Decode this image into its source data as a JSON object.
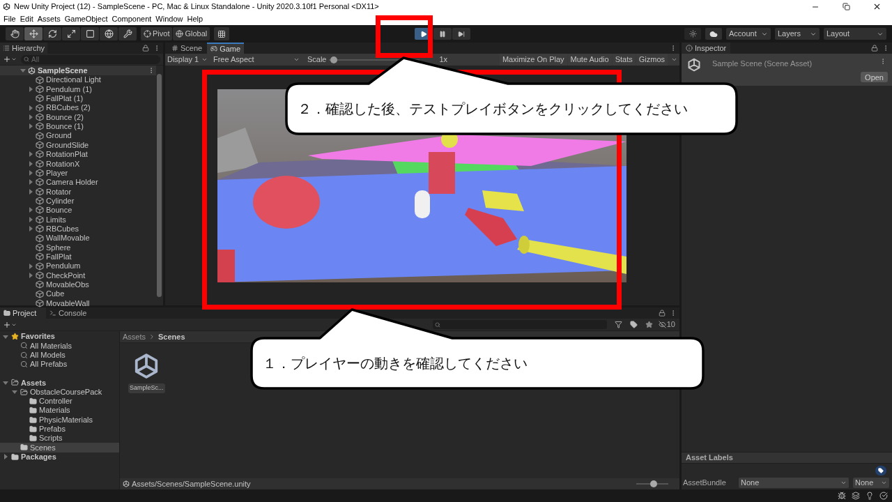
{
  "window": {
    "title": "New Unity Project (12) - SampleScene - PC, Mac & Linux Standalone - Unity 2020.3.10f1 Personal <DX11>"
  },
  "menu": [
    "File",
    "Edit",
    "Assets",
    "GameObject",
    "Component",
    "Window",
    "Help"
  ],
  "toolbar": {
    "tools": [
      {
        "kind": "hand",
        "selected": false
      },
      {
        "kind": "move",
        "selected": true
      },
      {
        "kind": "rotate",
        "selected": false
      },
      {
        "kind": "scale",
        "selected": false
      },
      {
        "kind": "rect",
        "selected": false
      },
      {
        "kind": "transform",
        "selected": false
      },
      {
        "kind": "custom",
        "selected": false
      }
    ],
    "pivot": "Pivot",
    "global": "Global",
    "play_active": true,
    "account": "Account",
    "layers": "Layers",
    "layout": "Layout"
  },
  "hierarchy": {
    "title": "Hierarchy",
    "search_placeholder": "All",
    "scene": {
      "name": "SampleScene",
      "expanded": true
    },
    "items": [
      {
        "name": "Directional Light",
        "expandable": false
      },
      {
        "name": "Pendulum (1)",
        "expandable": true
      },
      {
        "name": "FallPlat (1)",
        "expandable": false
      },
      {
        "name": "RBCubes (2)",
        "expandable": true
      },
      {
        "name": "Bounce (2)",
        "expandable": true
      },
      {
        "name": "Bounce (1)",
        "expandable": true
      },
      {
        "name": "Ground",
        "expandable": false
      },
      {
        "name": "GroundSlide",
        "expandable": false
      },
      {
        "name": "RotationPlat",
        "expandable": true
      },
      {
        "name": "RotationX",
        "expandable": true
      },
      {
        "name": "Player",
        "expandable": true
      },
      {
        "name": "Camera Holder",
        "expandable": true
      },
      {
        "name": "Rotator",
        "expandable": true
      },
      {
        "name": "Cylinder",
        "expandable": false
      },
      {
        "name": "Bounce",
        "expandable": true
      },
      {
        "name": "Limits",
        "expandable": true
      },
      {
        "name": "RBCubes",
        "expandable": true
      },
      {
        "name": "WallMovable",
        "expandable": false
      },
      {
        "name": "Sphere",
        "expandable": false
      },
      {
        "name": "FallPlat",
        "expandable": false
      },
      {
        "name": "Pendulum",
        "expandable": true
      },
      {
        "name": "CheckPoint",
        "expandable": true
      },
      {
        "name": "MovableObs",
        "expandable": false
      },
      {
        "name": "Cube",
        "expandable": false
      },
      {
        "name": "MovableWall",
        "expandable": false
      }
    ]
  },
  "game_panel": {
    "tabs": [
      {
        "label": "Scene",
        "kind": "scene",
        "selected": false
      },
      {
        "label": "Game",
        "kind": "game",
        "selected": true
      }
    ],
    "display": "Display 1",
    "aspect": "Free Aspect",
    "scale_label": "Scale",
    "scale": {
      "level": 0.05
    },
    "scale_value": "1x",
    "buttons": [
      "Maximize On Play",
      "Mute Audio",
      "Stats",
      "Gizmos"
    ]
  },
  "inspector": {
    "title": "Inspector",
    "asset": "Sample Scene (Scene Asset)",
    "open": "Open",
    "asset_labels": "Asset Labels",
    "bundle_label": "AssetBundle",
    "bundle": "None",
    "variant": "None"
  },
  "project": {
    "tabs": [
      {
        "label": "Project",
        "kind": "project",
        "selected": true
      },
      {
        "label": "Console",
        "kind": "console",
        "selected": false
      }
    ],
    "tree": [
      {
        "name": "Favorites",
        "kind": "star",
        "expanded": true,
        "selected": false,
        "children": [
          {
            "name": "All Materials",
            "kind": "search",
            "selected": false
          },
          {
            "name": "All Models",
            "kind": "search",
            "selected": false
          },
          {
            "name": "All Prefabs",
            "kind": "search",
            "selected": false
          }
        ]
      },
      {
        "name": "Assets",
        "kind": "folder",
        "expanded": true,
        "selected": false,
        "children": [
          {
            "name": "ObstacleCoursePack",
            "kind": "folder",
            "expanded": true,
            "selected": false,
            "children": [
              {
                "name": "Controller",
                "kind": "folder",
                "selected": false
              },
              {
                "name": "Materials",
                "kind": "folder",
                "selected": false
              },
              {
                "name": "PhysicMaterials",
                "kind": "folder",
                "selected": false
              },
              {
                "name": "Prefabs",
                "kind": "folder",
                "selected": false
              },
              {
                "name": "Scripts",
                "kind": "folder",
                "selected": false
              }
            ]
          },
          {
            "name": "Scenes",
            "kind": "folder",
            "selected": true
          }
        ]
      },
      {
        "name": "Packages",
        "kind": "folder",
        "expanded": false,
        "selected": false
      }
    ],
    "breadcrumb": [
      "Assets",
      "Scenes"
    ],
    "hidden_count": "10",
    "files": [
      "SampleSc..."
    ],
    "path": "Assets/Scenes/SampleScene.unity",
    "zoom": {
      "level": 0.55
    }
  },
  "callouts": [
    {
      "text": "２．確認した後、テストプレイボタンをクリックしてください"
    },
    {
      "text": "１．プレイヤーの動きを確認してください"
    }
  ]
}
